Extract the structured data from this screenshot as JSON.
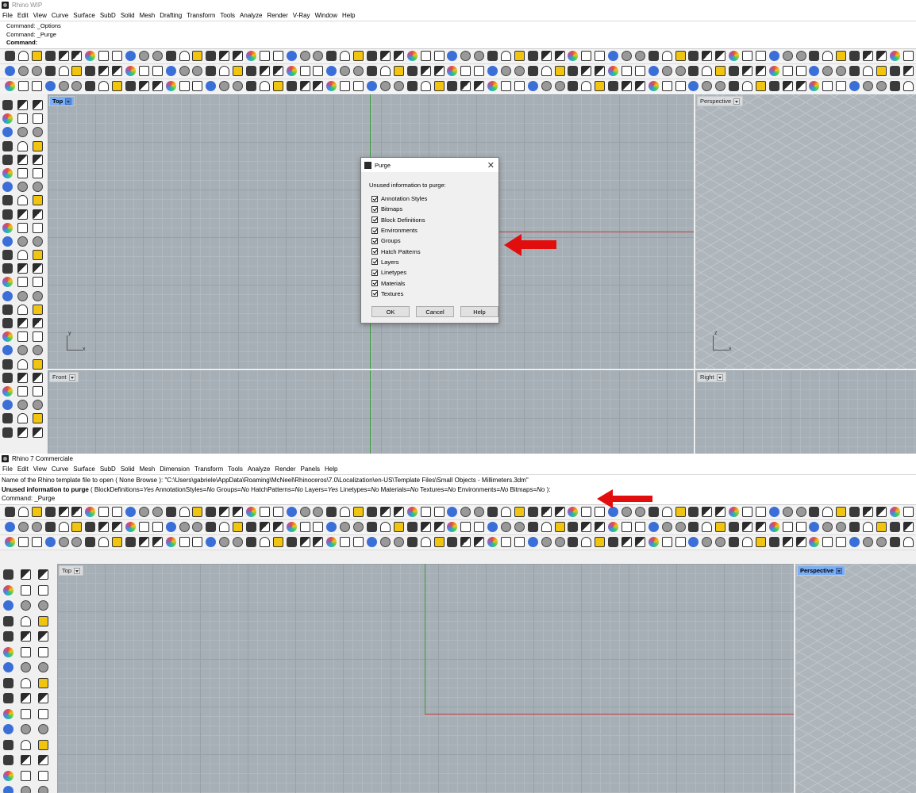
{
  "colors": {
    "arrow": "#e20d0d",
    "viewport_bg": "#a6afb6",
    "active_label": "#7aaef5",
    "axis_x": "#c43d3d",
    "axis_y": "#3d9a3d"
  },
  "top_window": {
    "title": "Rhino WIP",
    "menu": [
      "File",
      "Edit",
      "View",
      "Curve",
      "Surface",
      "SubD",
      "Solid",
      "Mesh",
      "Drafting",
      "Transform",
      "Tools",
      "Analyze",
      "Render",
      "V-Ray",
      "Window",
      "Help"
    ],
    "command_history": [
      "Command: _Options",
      "Command: _Purge"
    ],
    "command_prompt": "Command:",
    "viewports": {
      "top": "Top",
      "perspective": "Perspective",
      "front": "Front",
      "right": "Right"
    },
    "axis_labels": {
      "x": "x",
      "y": "y",
      "z": "z"
    },
    "purge_dialog": {
      "title": "Purge",
      "close": "✕",
      "prompt": "Unused information to purge:",
      "items": [
        "Annotation Styles",
        "Bitmaps",
        "Block Definitions",
        "Environments",
        "Groups",
        "Hatch Patterns",
        "Layers",
        "Linetypes",
        "Materials",
        "Textures"
      ],
      "buttons": {
        "ok": "OK",
        "cancel": "Cancel",
        "help": "Help"
      }
    }
  },
  "bottom_window": {
    "title": "Rhino 7 Commerciale",
    "menu": [
      "File",
      "Edit",
      "View",
      "Curve",
      "Surface",
      "SubD",
      "Solid",
      "Mesh",
      "Dimension",
      "Transform",
      "Tools",
      "Analyze",
      "Render",
      "Panels",
      "Help"
    ],
    "template_line": "Name of the Rhino template file to open ( None  Browse ): \"C:\\Users\\gabriele\\AppData\\Roaming\\McNeel\\Rhinoceros\\7.0\\Localization\\en-US\\Template Files\\Small Objects - Millimeters.3dm\"",
    "purge_prompt": {
      "label": "Unused information to purge",
      "open": " ( ",
      "options": [
        {
          "name": "BlockDefinitions",
          "value": "Yes"
        },
        {
          "name": "AnnotationStyles",
          "value": "No"
        },
        {
          "name": "Groups",
          "value": "No"
        },
        {
          "name": "HatchPatterns",
          "value": "No"
        },
        {
          "name": "Layers",
          "value": "Yes"
        },
        {
          "name": "Linetypes",
          "value": "No"
        },
        {
          "name": "Materials",
          "value": "No"
        },
        {
          "name": "Textures",
          "value": "No"
        },
        {
          "name": "Environments",
          "value": "No"
        },
        {
          "name": "Bitmaps",
          "value": "No"
        }
      ],
      "close": " ):"
    },
    "command_history": "Command: _Purge",
    "viewports": {
      "top": "Top",
      "perspective": "Perspective"
    }
  }
}
